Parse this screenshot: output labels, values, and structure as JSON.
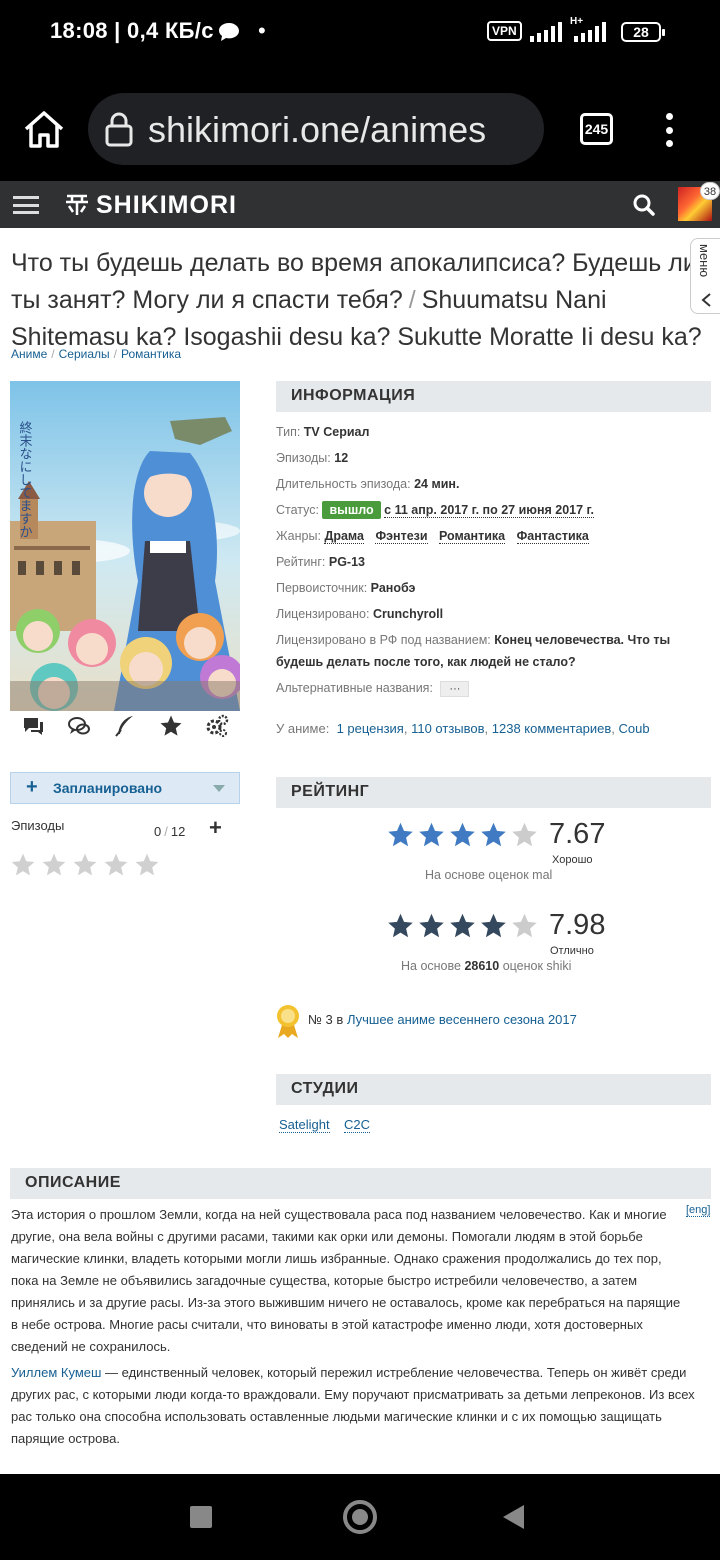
{
  "status_bar": {
    "time": "18:08 | 0,4 КБ/с",
    "dot": "•",
    "vpn": "VPN",
    "network": "H+",
    "battery": "28"
  },
  "browser": {
    "url": "shikimori.one/animes",
    "tab_count": "245"
  },
  "site": {
    "logo": "SHIKIMORI",
    "notification_count": "38"
  },
  "page": {
    "title_ru": "Что ты будешь делать во время апокалипсиса? Будешь ли ты занят? Могу ли я спасти тебя?",
    "title_sep": "/",
    "title_romaji": "Shuumatsu Nani Shitemasu ka? Isogashii desu ka? Sukutte Moratte Ii desu ka?",
    "menu_label": "меню",
    "breadcrumb": [
      "Аниме",
      "Сериалы",
      "Романтика"
    ],
    "breadcrumb_sep": "/"
  },
  "user_list": {
    "plan_label": "Запланировано",
    "plan_plus": "+",
    "episodes_label": "Эпизоды",
    "episodes_watched": "0",
    "episodes_sep": "/",
    "episodes_total": "12",
    "episodes_plus": "+",
    "user_rating_stars": 0
  },
  "info": {
    "heading": "ИНФОРМАЦИЯ",
    "type_k": "Тип:",
    "type_v": "TV Сериал",
    "episodes_k": "Эпизоды:",
    "episodes_v": "12",
    "duration_k": "Длительность эпизода:",
    "duration_v": "24 мин.",
    "status_k": "Статус:",
    "status_badge": "вышло",
    "status_v": "с 11 апр. 2017 г. по 27 июня 2017 г.",
    "genres_k": "Жанры:",
    "genres": [
      "Драма",
      "Фэнтези",
      "Романтика",
      "Фантастика"
    ],
    "rating_k": "Рейтинг:",
    "rating_v": "PG-13",
    "source_k": "Первоисточник:",
    "source_v": "Ранобэ",
    "licensed_k": "Лицензировано:",
    "licensed_v": "Crunchyroll",
    "licensed_ru_k": "Лицензировано в РФ под названием:",
    "licensed_ru_v": "Конец человечества. Что ты будешь делать после того, как людей не стало?",
    "alt_k": "Альтернативные названия:",
    "alt_v": "···"
  },
  "about": {
    "label": "У аниме:",
    "links": [
      "1 рецензия",
      "110 отзывов",
      "1238 комментариев",
      "Coub"
    ]
  },
  "rating": {
    "heading": "РЕЙТИНГ",
    "mal_score": "7.67",
    "mal_stars": 4,
    "mal_word": "Хорошо",
    "mal_basis": "На основе оценок mal",
    "shiki_score": "7.98",
    "shiki_stars": 4,
    "shiki_word": "Отлично",
    "shiki_basis_pre": "На основе",
    "shiki_basis_count": "28610",
    "shiki_basis_post": "оценок shiki",
    "rank_pre": "№ 3 в",
    "rank_link": "Лучшее аниме весеннего сезона 2017",
    "star_filled_mal": "#3f7ac2",
    "star_filled_shiki": "#34495e",
    "star_empty": "#cccccc"
  },
  "studios": {
    "heading": "СТУДИИ",
    "items": [
      "Satelight",
      "C2C"
    ]
  },
  "description": {
    "heading": "ОПИСАНИЕ",
    "eng_link": "[eng]",
    "p1": "Эта история о прошлом Земли, когда на ней существовала раса под названием человечество. Как и многие другие, она вела войны с другими расами, такими как орки или демоны. Помогали людям в этой борьбе магические клинки, владеть которыми могли лишь избранные. Однако сражения продолжались до тех пор, пока на Земле не объявились загадочные существа, которые быстро истребили человечество, а затем принялись и за другие расы. Из-за этого выжившим ничего не оставалось, кроме как перебраться на парящие в небе острова. Многие расы считали, что виноваты в этой катастрофе именно люди, хотя достоверных сведений не сохранилось.",
    "p2_link": "Уиллем Кумеш",
    "p2_rest": " — единственный человек, который пережил истребление человечества. Теперь он живёт среди других рас, с которыми люди когда-то враждовали. Ему поручают присматривать за детьми лепреконов. Из всех рас только она способна использовать оставленные людьми магические клинки и с их помощью защищать парящие острова."
  }
}
